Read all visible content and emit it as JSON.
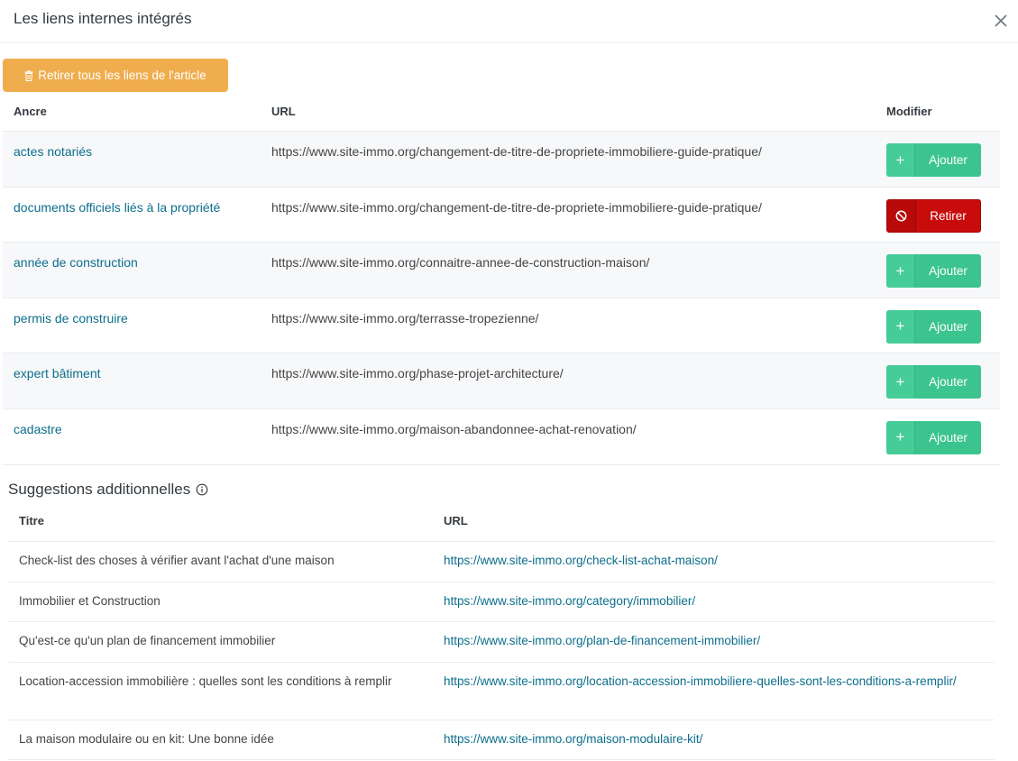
{
  "modal": {
    "title": "Les liens internes intégrés",
    "close_icon": "close-icon"
  },
  "remove_all_button": {
    "label": "Retirer tous les liens de l'article",
    "icon": "trash-icon",
    "color": "#f0ad4e"
  },
  "links_table": {
    "headers": {
      "anchor": "Ancre",
      "url": "URL",
      "modify": "Modifier"
    },
    "rows": [
      {
        "anchor": "actes notariés",
        "url": "https://www.site-immo.org/changement-de-titre-de-propriete-immobiliere-guide-pratique/",
        "action": "Ajouter",
        "action_icon": "plus-icon"
      },
      {
        "anchor": "documents officiels liés à la propriété",
        "url": "https://www.site-immo.org/changement-de-titre-de-propriete-immobiliere-guide-pratique/",
        "action": "Retirer",
        "action_icon": "ban-icon"
      },
      {
        "anchor": "année de construction",
        "url": "https://www.site-immo.org/connaitre-annee-de-construction-maison/",
        "action": "Ajouter",
        "action_icon": "plus-icon"
      },
      {
        "anchor": "permis de construire",
        "url": "https://www.site-immo.org/terrasse-tropezienne/",
        "action": "Ajouter",
        "action_icon": "plus-icon"
      },
      {
        "anchor": "expert bâtiment",
        "url": "https://www.site-immo.org/phase-projet-architecture/",
        "action": "Ajouter",
        "action_icon": "plus-icon"
      },
      {
        "anchor": "cadastre",
        "url": "https://www.site-immo.org/maison-abandonnee-achat-renovation/",
        "action": "Ajouter",
        "action_icon": "plus-icon"
      }
    ]
  },
  "suggestions": {
    "title": "Suggestions additionnelles",
    "info_icon": "info-icon",
    "headers": {
      "title": "Titre",
      "url": "URL"
    },
    "rows": [
      {
        "title": "Check-list des choses à vérifier avant l'achat d'une maison",
        "url": "https://www.site-immo.org/check-list-achat-maison/"
      },
      {
        "title": "Immobilier et Construction",
        "url": "https://www.site-immo.org/category/immobilier/"
      },
      {
        "title": "Qu'est-ce qu'un plan de financement immobilier",
        "url": "https://www.site-immo.org/plan-de-financement-immobilier/"
      },
      {
        "title": "Location-accession immobilière : quelles sont les conditions à remplir",
        "url": "https://www.site-immo.org/location-accession-immobiliere-quelles-sont-les-conditions-a-remplir/"
      },
      {
        "title": "La maison modulaire ou en kit: Une bonne idée",
        "url": "https://www.site-immo.org/maison-modulaire-kit/"
      }
    ]
  },
  "colors": {
    "link": "#0c6e8c",
    "add_button": "#3cc48f",
    "remove_button": "#c80b0b",
    "row_stripe": "#f7f8fa"
  }
}
